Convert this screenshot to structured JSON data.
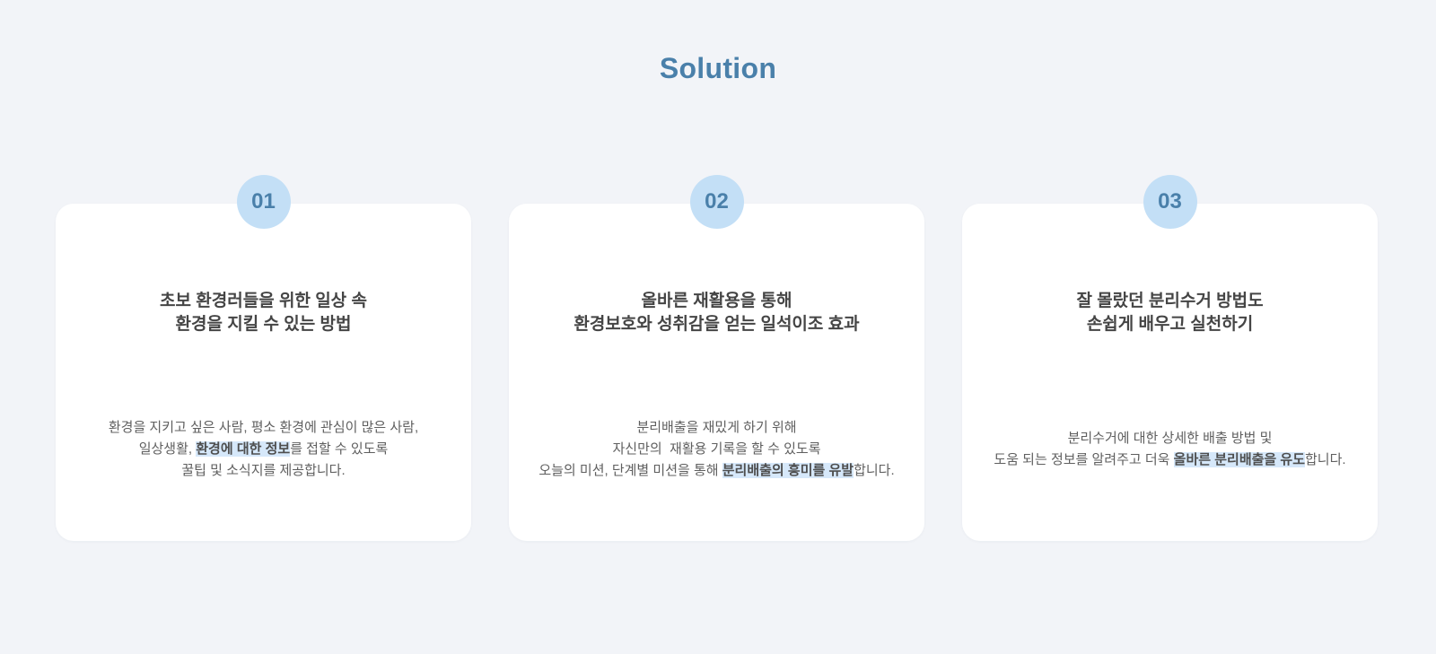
{
  "section": {
    "title": "Solution"
  },
  "cards": [
    {
      "number": "01",
      "title_lines": [
        "초보 환경러들을 위한 일상 속",
        "환경을 지킬 수 있는 방법"
      ],
      "desc": {
        "line1": "환경을 지키고 싶은 사람, 평소 환경에 관심이 많은 사람,",
        "line2_before": "일상생활, ",
        "line2_highlight": "환경에 대한 정보",
        "line2_after": "를 접할 수 있도록",
        "line3": "꿀팁 및 소식지를 제공합니다."
      }
    },
    {
      "number": "02",
      "title_lines": [
        "올바른 재활용을 통해",
        "환경보호와 성취감을 얻는 일석이조 효과"
      ],
      "desc": {
        "line1": "분리배출을 재밌게 하기 위해",
        "line2": "자신만의  재활용 기록을 할 수 있도록",
        "line3_before": "오늘의 미션, 단계별 미션을 통해 ",
        "line3_highlight": "분리배출의 흥미를 유발",
        "line3_after": "합니다."
      }
    },
    {
      "number": "03",
      "title_lines": [
        "잘 몰랐던 분리수거 방법도",
        "손쉽게 배우고 실천하기"
      ],
      "desc": {
        "line1": "분리수거에 대한 상세한 배출 방법 및",
        "line2_before": "도움 되는 정보를 알려주고 더욱 ",
        "line2_highlight": "올바른 분리배출을 유도",
        "line2_after": "합니다."
      }
    }
  ],
  "colors": {
    "background": "#f2f4f8",
    "accent": "#4a80aa",
    "badge": "#c3dff6",
    "highlight": "#d6e8fa"
  }
}
